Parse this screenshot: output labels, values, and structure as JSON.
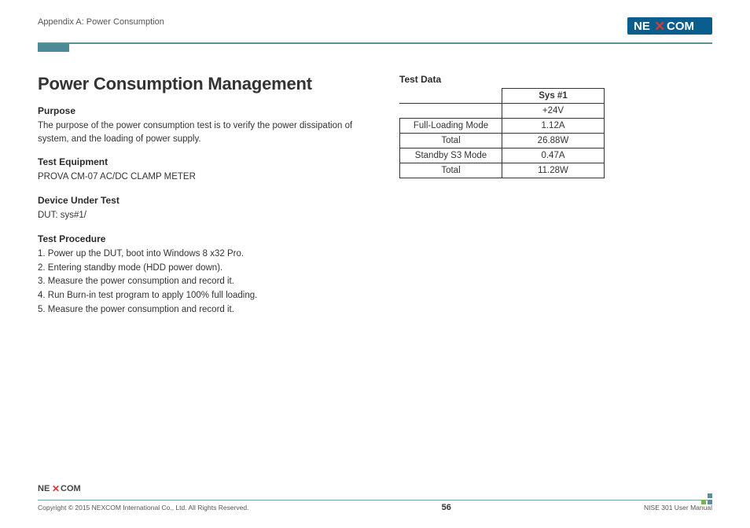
{
  "header": {
    "appendix": "Appendix A: Power Consumption",
    "brand": "NEXCOM"
  },
  "main": {
    "title": "Power Consumption Management",
    "purpose": {
      "heading": "Purpose",
      "text": "The purpose of the power consumption test is to verify the power dissipation of system, and the loading of power supply."
    },
    "equipment": {
      "heading": "Test Equipment",
      "text": "PROVA CM-07 AC/DC CLAMP METER"
    },
    "dut": {
      "heading": "Device Under Test",
      "text": "DUT: sys#1/"
    },
    "procedure": {
      "heading": "Test Procedure",
      "steps": [
        "1. Power up the DUT, boot into Windows 8 x32 Pro.",
        "2. Entering standby mode (HDD power down).",
        "3. Measure the power consumption and record it.",
        "4. Run Burn-in test program to apply 100% full loading.",
        "5. Measure the power consumption and record it."
      ]
    }
  },
  "testdata": {
    "heading": "Test Data",
    "col_header": "Sys #1",
    "voltage": "+24V",
    "rows": [
      {
        "label": "Full-Loading Mode",
        "value": "1.12A"
      },
      {
        "label": "Total",
        "value": "26.88W"
      },
      {
        "label": "Standby S3 Mode",
        "value": "0.47A"
      },
      {
        "label": "Total",
        "value": "11.28W"
      }
    ]
  },
  "footer": {
    "copyright": "Copyright © 2015 NEXCOM International Co., Ltd. All Rights Reserved.",
    "page": "56",
    "manual": "NISE 301 User Manual"
  }
}
